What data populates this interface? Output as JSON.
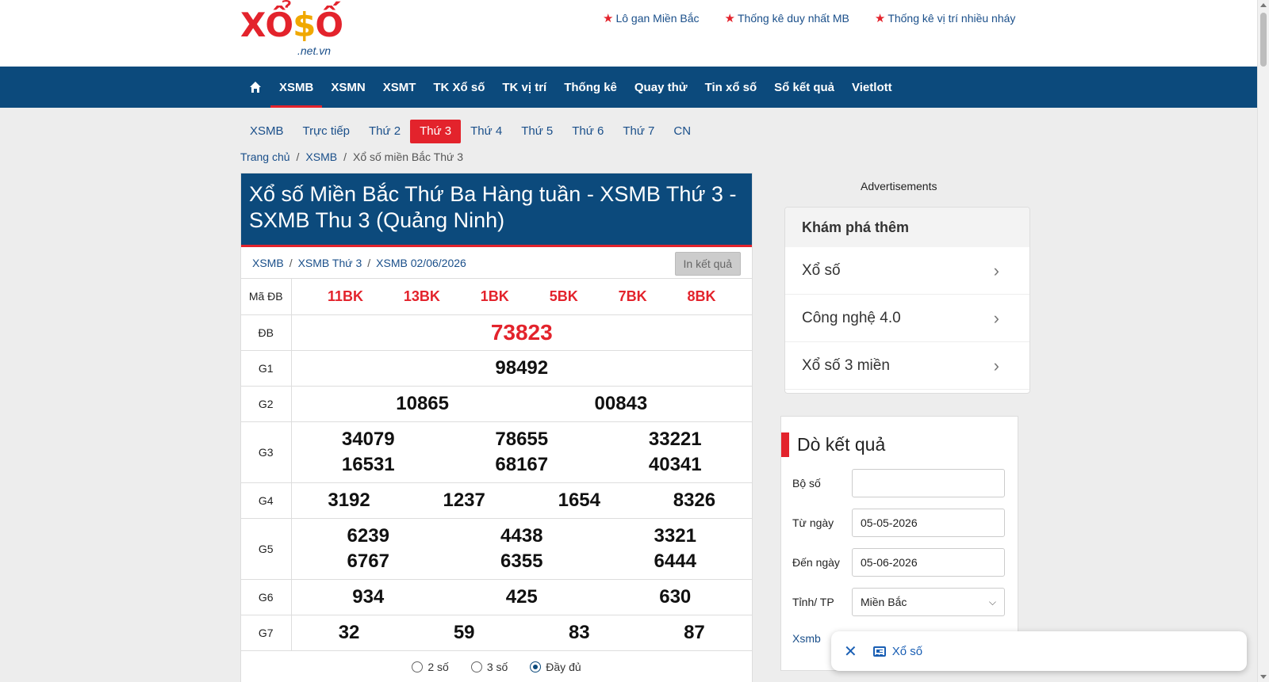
{
  "logo": {
    "word_a": "XỔ",
    "word_b": "$",
    "word_c": "Ố",
    "sub": ".net.vn"
  },
  "toplinks": [
    "Lô gan Miền Bắc",
    "Thống kê duy nhất MB",
    "Thống kê vị trí nhiều nháy"
  ],
  "nav": [
    "XSMB",
    "XSMN",
    "XSMT",
    "TK Xổ số",
    "TK vị trí",
    "Thống kê",
    "Quay thử",
    "Tin xổ số",
    "Sổ kết quả",
    "Vietlott"
  ],
  "daytabs": [
    "XSMB",
    "Trực tiếp",
    "Thứ 2",
    "Thứ 3",
    "Thứ 4",
    "Thứ 5",
    "Thứ 6",
    "Thứ 7",
    "CN"
  ],
  "breadcrumb": [
    "Trang chủ",
    "XSMB",
    "Xổ số miền Bắc Thứ 3"
  ],
  "panel": {
    "title": "Xổ số Miền Bắc Thứ Ba Hàng tuần - XSMB Thứ 3 - SXMB Thu 3 (Quảng Ninh)",
    "sublinks": [
      "XSMB",
      "XSMB Thứ 3",
      "XSMB 02/06/2026"
    ],
    "print_label": "In kết quả"
  },
  "results": {
    "ma_label": "Mã ĐB",
    "ma_codes": [
      "11BK",
      "13BK",
      "1BK",
      "5BK",
      "7BK",
      "8BK"
    ],
    "db_label": "ĐB",
    "db": "73823",
    "g1_label": "G1",
    "g1": "98492",
    "g2_label": "G2",
    "g2": [
      "10865",
      "00843"
    ],
    "g3_label": "G3",
    "g3": [
      "34079",
      "78655",
      "33221",
      "16531",
      "68167",
      "40341"
    ],
    "g4_label": "G4",
    "g4": [
      "3192",
      "1237",
      "1654",
      "8326"
    ],
    "g5_label": "G5",
    "g5": [
      "6239",
      "4438",
      "3321",
      "6767",
      "6355",
      "6444"
    ],
    "g6_label": "G6",
    "g6": [
      "934",
      "425",
      "630"
    ],
    "g7_label": "G7",
    "g7": [
      "32",
      "59",
      "83",
      "87"
    ]
  },
  "radios": [
    "2 số",
    "3 số",
    "Đầy đủ"
  ],
  "ads_label": "Advertisements",
  "explore": {
    "title": "Khám phá thêm",
    "items": [
      "Xổ số",
      "Công nghệ 4.0",
      "Xổ số 3 miền"
    ]
  },
  "search": {
    "title": "Dò kết quả",
    "bo_so_label": "Bộ số",
    "bo_so_value": "",
    "tu_ngay_label": "Từ ngày",
    "tu_ngay_value": "05-05-2026",
    "den_ngay_label": "Đến ngày",
    "den_ngay_value": "05-06-2026",
    "tinh_label": "Tỉnh/ TP",
    "tinh_value": "Miền Bắc",
    "xsmb_link": "Xsmb"
  },
  "floatbar": {
    "item": "Xổ số"
  }
}
